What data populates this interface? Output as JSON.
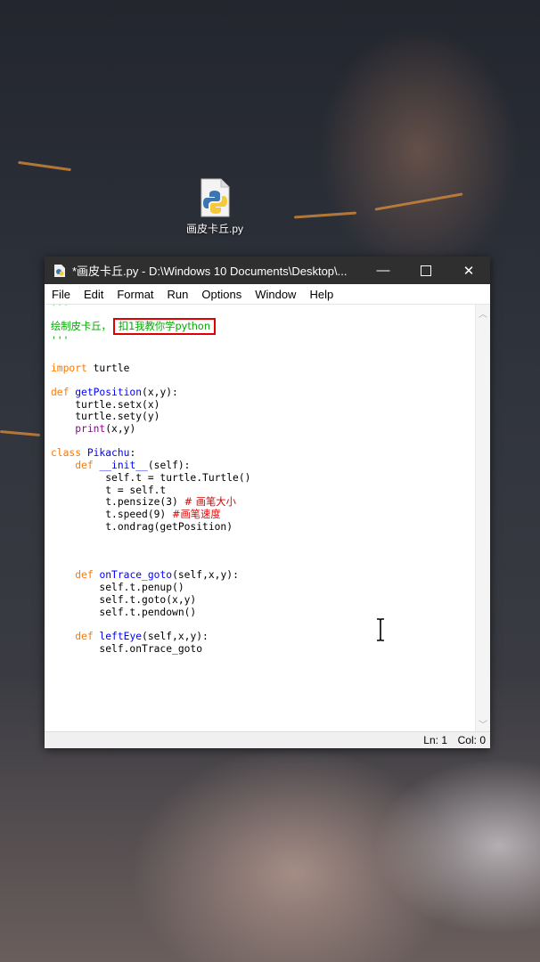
{
  "desktop": {
    "icon_label": "画皮卡丘.py",
    "icon": "python-file-icon"
  },
  "window": {
    "title": "*画皮卡丘.py - D:\\Windows 10 Documents\\Desktop\\...",
    "menu": [
      "File",
      "Edit",
      "Format",
      "Run",
      "Options",
      "Window",
      "Help"
    ],
    "status": {
      "line": "Ln: 1",
      "col": "Col: 0"
    }
  },
  "colors": {
    "keyword": "#ff7700",
    "definition": "#0000ff",
    "builtin": "#900090",
    "string": "#00aa00",
    "comment": "#dd0000",
    "text": "#000000",
    "highlight_box": "#e00000"
  },
  "code": [
    {
      "row": 0,
      "seg": [
        {
          "t": "'''",
          "c": "string"
        }
      ]
    },
    {
      "row": 1.6,
      "seg": [
        {
          "t": "绘制皮卡丘，",
          "c": "string"
        },
        {
          "t": "扣1我教你学python",
          "c": "string",
          "box": true
        }
      ]
    },
    {
      "row": 2.8,
      "seg": [
        {
          "t": "'''",
          "c": "string"
        }
      ]
    },
    {
      "row": 5,
      "seg": [
        {
          "t": "import",
          "c": "keyword"
        },
        {
          "t": " turtle",
          "c": "text"
        }
      ]
    },
    {
      "row": 7,
      "seg": [
        {
          "t": "def",
          "c": "keyword"
        },
        {
          "t": " ",
          "c": "text"
        },
        {
          "t": "getPosition",
          "c": "definition"
        },
        {
          "t": "(x,y):",
          "c": "text"
        }
      ]
    },
    {
      "row": 8,
      "seg": [
        {
          "t": "    turtle.setx(x)",
          "c": "text"
        }
      ]
    },
    {
      "row": 9,
      "seg": [
        {
          "t": "    turtle.sety(y)",
          "c": "text"
        }
      ]
    },
    {
      "row": 10,
      "seg": [
        {
          "t": "    ",
          "c": "text"
        },
        {
          "t": "print",
          "c": "builtin"
        },
        {
          "t": "(x,y)",
          "c": "text"
        }
      ]
    },
    {
      "row": 12,
      "seg": [
        {
          "t": "class",
          "c": "keyword"
        },
        {
          "t": " ",
          "c": "text"
        },
        {
          "t": "Pikachu",
          "c": "definition"
        },
        {
          "t": ":",
          "c": "text"
        }
      ]
    },
    {
      "row": 13,
      "seg": [
        {
          "t": "    ",
          "c": "text"
        },
        {
          "t": "def",
          "c": "keyword"
        },
        {
          "t": " ",
          "c": "text"
        },
        {
          "t": "__init__",
          "c": "definition"
        },
        {
          "t": "(self):",
          "c": "text"
        }
      ]
    },
    {
      "row": 14,
      "seg": [
        {
          "t": "         self.t = turtle.Turtle()",
          "c": "text"
        }
      ]
    },
    {
      "row": 15,
      "seg": [
        {
          "t": "         t = self.t",
          "c": "text"
        }
      ]
    },
    {
      "row": 16,
      "seg": [
        {
          "t": "         t.pensize(3) ",
          "c": "text"
        },
        {
          "t": "# 画笔大小",
          "c": "comment"
        }
      ]
    },
    {
      "row": 17,
      "seg": [
        {
          "t": "         t.speed(9) ",
          "c": "text"
        },
        {
          "t": "#画笔速度",
          "c": "comment"
        }
      ]
    },
    {
      "row": 18,
      "seg": [
        {
          "t": "         t.ondrag(getPosition)",
          "c": "text"
        }
      ]
    },
    {
      "row": 22,
      "seg": [
        {
          "t": "    ",
          "c": "text"
        },
        {
          "t": "def",
          "c": "keyword"
        },
        {
          "t": " ",
          "c": "text"
        },
        {
          "t": "onTrace_goto",
          "c": "definition"
        },
        {
          "t": "(self,x,y):",
          "c": "text"
        }
      ]
    },
    {
      "row": 23,
      "seg": [
        {
          "t": "        self.t.penup()",
          "c": "text"
        }
      ]
    },
    {
      "row": 24,
      "seg": [
        {
          "t": "        self.t.goto(x,y)",
          "c": "text"
        }
      ]
    },
    {
      "row": 25,
      "seg": [
        {
          "t": "        self.t.pendown()",
          "c": "text"
        }
      ]
    },
    {
      "row": 27,
      "seg": [
        {
          "t": "    ",
          "c": "text"
        },
        {
          "t": "def",
          "c": "keyword"
        },
        {
          "t": " ",
          "c": "text"
        },
        {
          "t": "leftEye",
          "c": "definition"
        },
        {
          "t": "(self,x,y):",
          "c": "text"
        }
      ]
    },
    {
      "row": 28,
      "seg": [
        {
          "t": "        self.onTrace_goto",
          "c": "text"
        }
      ]
    }
  ]
}
